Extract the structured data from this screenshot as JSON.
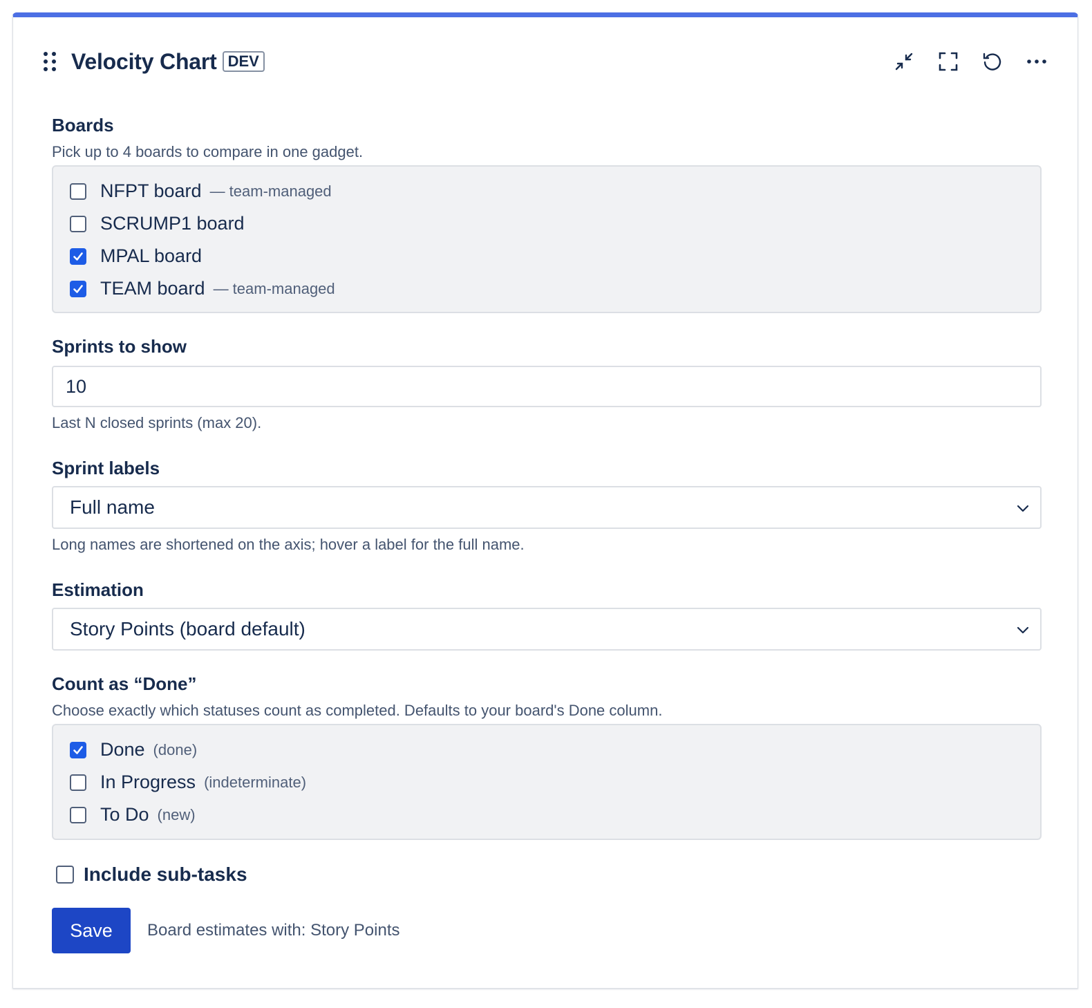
{
  "header": {
    "title": "Velocity Chart",
    "badge": "DEV",
    "tools": [
      "shrink-icon",
      "fullscreen-icon",
      "refresh-icon",
      "more-icon"
    ]
  },
  "boards": {
    "label": "Boards",
    "help": "Pick up to 4 boards to compare in one gadget.",
    "items": [
      {
        "label": "NFPT board",
        "meta": "— team-managed",
        "checked": false
      },
      {
        "label": "SCRUMP1 board",
        "meta": "",
        "checked": false
      },
      {
        "label": "MPAL board",
        "meta": "",
        "checked": true
      },
      {
        "label": "TEAM board",
        "meta": "— team-managed",
        "checked": true
      }
    ]
  },
  "sprints": {
    "label": "Sprints to show",
    "value": "10",
    "help": "Last N closed sprints (max 20)."
  },
  "sprint_labels": {
    "label": "Sprint labels",
    "selected": "Full name",
    "help": "Long names are shortened on the axis; hover a label for the full name."
  },
  "estimation": {
    "label": "Estimation",
    "selected": "Story Points (board default)"
  },
  "done": {
    "label": "Count as “Done”",
    "help": "Choose exactly which statuses count as completed. Defaults to your board's Done column.",
    "items": [
      {
        "label": "Done",
        "meta": "(done)",
        "checked": true
      },
      {
        "label": "In Progress",
        "meta": "(indeterminate)",
        "checked": false
      },
      {
        "label": "To Do",
        "meta": "(new)",
        "checked": false
      }
    ]
  },
  "subtasks": {
    "label": "Include sub-tasks",
    "checked": false
  },
  "footer": {
    "save_label": "Save",
    "note": "Board estimates with: Story Points"
  },
  "colors": {
    "accent": "#4c6fe4",
    "checkbox": "#1d5ce6",
    "save_button": "#1d46c5"
  }
}
